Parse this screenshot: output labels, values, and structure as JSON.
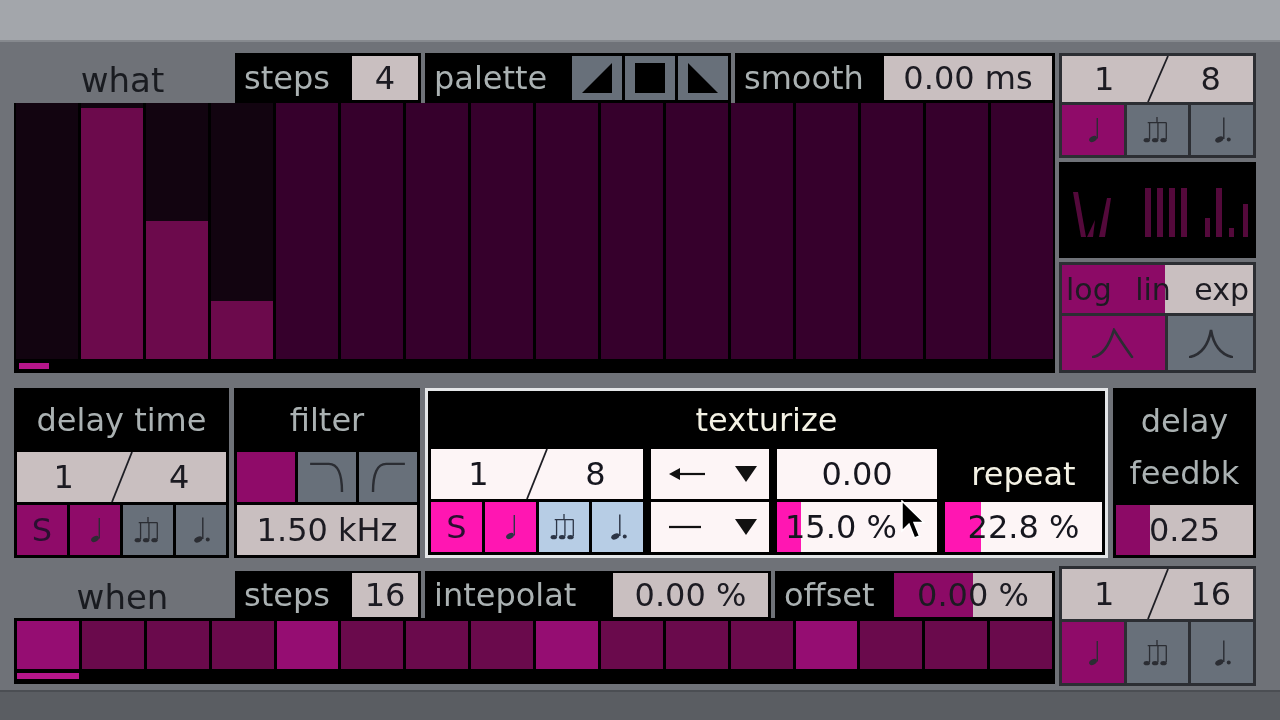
{
  "what": {
    "label": "what",
    "steps": {
      "label": "steps",
      "value": "4"
    },
    "palette": {
      "label": "palette",
      "buttons": [
        {
          "kind": "rise"
        },
        {
          "kind": "flat"
        },
        {
          "kind": "fall"
        }
      ]
    },
    "smooth": {
      "label": "smooth",
      "value": "0.00 ms"
    },
    "bars": [
      {
        "active": true,
        "current": true,
        "level": 0
      },
      {
        "active": true,
        "current": false,
        "level": 1
      },
      {
        "active": true,
        "current": false,
        "level": 0.55
      },
      {
        "active": true,
        "current": false,
        "level": 0.23
      },
      {
        "active": false,
        "current": false
      },
      {
        "active": false,
        "current": false
      },
      {
        "active": false,
        "current": false
      },
      {
        "active": false,
        "current": false
      },
      {
        "active": false,
        "current": false
      },
      {
        "active": false,
        "current": false
      },
      {
        "active": false,
        "current": false
      },
      {
        "active": false,
        "current": false
      },
      {
        "active": false,
        "current": false
      },
      {
        "active": false,
        "current": false
      },
      {
        "active": false,
        "current": false
      },
      {
        "active": false,
        "current": false
      }
    ]
  },
  "what_rate": {
    "numerator": "1",
    "denominator": "8",
    "modes": [
      {
        "kind": "note",
        "selected": true
      },
      {
        "kind": "triplet",
        "selected": false
      },
      {
        "kind": "dotted",
        "selected": false
      }
    ]
  },
  "curve": {
    "scale": {
      "labels": [
        "log",
        "lin",
        "exp"
      ],
      "level": 0.54
    },
    "shapes": [
      {
        "kind": "skewed",
        "selected": true
      },
      {
        "kind": "peak",
        "selected": false
      }
    ]
  },
  "delay_time": {
    "title": "delay time",
    "highlighted": false,
    "rate": {
      "numerator": "1",
      "denominator": "4",
      "sync": {
        "label": "S",
        "on": true
      },
      "modes": [
        {
          "kind": "note",
          "selected": true
        },
        {
          "kind": "triplet",
          "selected": false
        },
        {
          "kind": "dotted",
          "selected": false
        }
      ]
    }
  },
  "filter": {
    "title": "filter",
    "highlighted": false,
    "modes": [
      {
        "kind": "off",
        "selected": true
      },
      {
        "kind": "lowpass",
        "selected": false
      },
      {
        "kind": "highpass",
        "selected": false
      }
    ],
    "frequency": "1.50 kHz"
  },
  "texturize": {
    "title": "texturize",
    "highlighted": true,
    "rate": {
      "numerator": "1",
      "denominator": "8",
      "sync": {
        "label": "S",
        "on": true
      },
      "modes": [
        {
          "kind": "note",
          "selected": true
        },
        {
          "kind": "triplet",
          "selected": false
        },
        {
          "kind": "dotted",
          "selected": false
        }
      ]
    },
    "menus": [
      {
        "kind": "arrow"
      },
      {
        "kind": "line"
      }
    ],
    "amount": "0.00",
    "spread": {
      "value": "15.0 %",
      "level": 0.15
    },
    "repeat": {
      "label": "repeat",
      "value": "22.8 %",
      "level": 0.23
    }
  },
  "delay_feedback": {
    "title": "delay feedbk",
    "highlighted": false,
    "value": "0.25",
    "level": 0.25
  },
  "when": {
    "label": "when",
    "steps": {
      "label": "steps",
      "value": "16"
    },
    "interpolation": {
      "label": "intepolat",
      "value": "0.00 %"
    },
    "offset": {
      "label": "offset",
      "value": "0.00 %",
      "level": 0.5
    },
    "cells": [
      {
        "accent": true,
        "current": true
      },
      {
        "accent": false,
        "current": false
      },
      {
        "accent": false,
        "current": false
      },
      {
        "accent": false,
        "current": false
      },
      {
        "accent": true,
        "current": false
      },
      {
        "accent": false,
        "current": false
      },
      {
        "accent": false,
        "current": false
      },
      {
        "accent": false,
        "current": false
      },
      {
        "accent": true,
        "current": false
      },
      {
        "accent": false,
        "current": false
      },
      {
        "accent": false,
        "current": false
      },
      {
        "accent": false,
        "current": false
      },
      {
        "accent": true,
        "current": false
      },
      {
        "accent": false,
        "current": false
      },
      {
        "accent": false,
        "current": false
      },
      {
        "accent": false,
        "current": false
      }
    ]
  },
  "when_rate": {
    "numerator": "1",
    "denominator": "16",
    "modes": [
      {
        "kind": "note",
        "selected": true
      },
      {
        "kind": "triplet",
        "selected": false
      },
      {
        "kind": "dotted",
        "selected": false
      }
    ]
  }
}
